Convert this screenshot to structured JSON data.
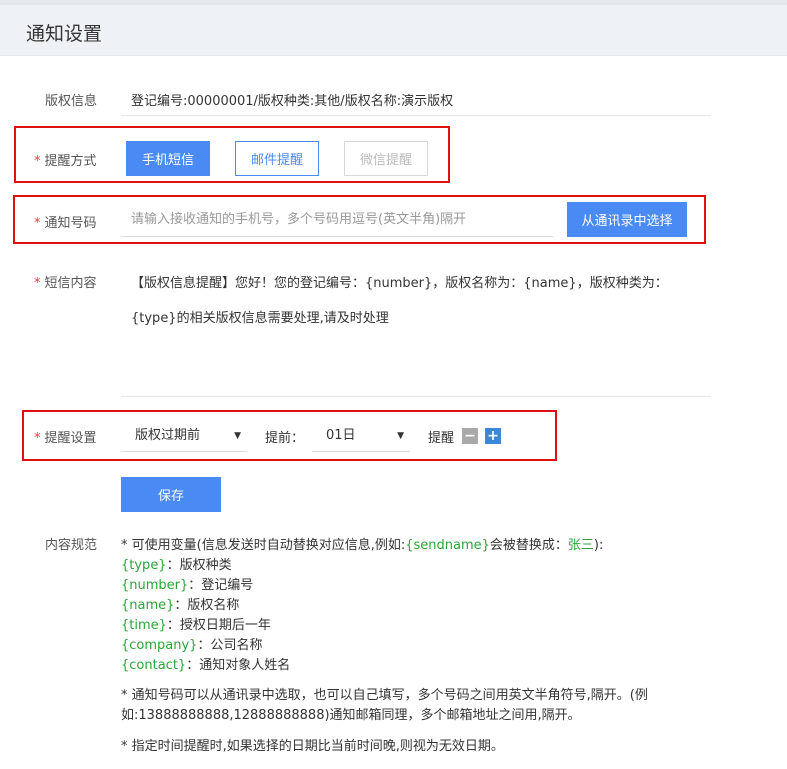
{
  "header": {
    "title": "通知设置"
  },
  "copyright": {
    "label": "版权信息",
    "value": "登记编号:00000001/版权种类:其他/版权名称:演示版权"
  },
  "remind_method": {
    "label": "提醒方式",
    "options": [
      "手机短信",
      "邮件提醒",
      "微信提醒"
    ]
  },
  "notify_number": {
    "label": "通知号码",
    "placeholder": "请输入接收通知的手机号，多个号码用逗号(英文半角)隔开",
    "button": "从通讯录中选择"
  },
  "sms": {
    "label": "短信内容",
    "line1": "【版权信息提醒】您好！您的登记编号：{number}，版权名称为：{name}，版权种类为：",
    "line2": "{type}的相关版权信息需要处理,请及时处理"
  },
  "remind_setting": {
    "label": "提醒设置",
    "select1": "版权过期前",
    "before_label": "提前：",
    "select2": "01日",
    "remind_label": "提醒"
  },
  "save_button": "保存",
  "rules": {
    "label": "内容规范",
    "intro_a": "* 可使用变量(信息发送时自动替换对应信息,例如:",
    "intro_var": "{sendname}",
    "intro_b": "会被替换成：",
    "intro_name": "张三",
    "intro_c": "):",
    "vars": [
      {
        "key": "{type}",
        "desc": "：版权种类"
      },
      {
        "key": "{number}",
        "desc": "：登记编号"
      },
      {
        "key": "{name}",
        "desc": "：版权名称"
      },
      {
        "key": "{time}",
        "desc": "：授权日期后一年"
      },
      {
        "key": "{company}",
        "desc": "：公司名称"
      },
      {
        "key": "{contact}",
        "desc": "：通知对象人姓名"
      }
    ],
    "note1_line1": "* 通知号码可以从通讯录中选取，也可以自己填写，多个号码之间用英文半角符号,隔开。(例",
    "note1_line2": "如:13888888888,12888888888)通知邮箱同理，多个邮箱地址之间用,隔开。",
    "note2": "* 指定时间提醒时,如果选择的日期比当前时间晚,则视为无效日期。"
  },
  "colors": {
    "primary": "#4a8af4",
    "required": "#e4393c",
    "highlight_box": "#e01010",
    "variable": "#2aa538"
  }
}
